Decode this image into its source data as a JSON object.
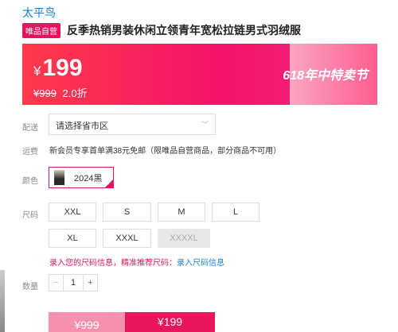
{
  "brand": "太平鸟",
  "vip_badge": "唯品自营",
  "product_title": "反季热销男装休闲立领青年宽松拉链男式羽绒服",
  "price": {
    "currency": "¥",
    "current": "199",
    "original": "¥999",
    "discount": "2.0折",
    "promo": "618年中特卖节"
  },
  "delivery": {
    "label": "配送",
    "placeholder": "请选择省市区"
  },
  "shipping": {
    "label": "运费",
    "text": "新会员专享首单满38元免邮（限唯品自营商品，部分商品不可用）"
  },
  "color": {
    "label": "颜色",
    "selected": "2024黑"
  },
  "size": {
    "label": "尺码",
    "options": [
      "XXL",
      "S",
      "M",
      "L",
      "XL",
      "XXXL",
      "XXXXL"
    ],
    "disabled": [
      "XXXXL"
    ],
    "hint_prefix": "录入您的尺码信息，精准推荐尺码：",
    "hint_link": "录入尺码信息"
  },
  "quantity": {
    "label": "数量",
    "value": "1",
    "minus": "−",
    "plus": "+"
  },
  "buttons": {
    "original_price": "¥999",
    "buy_price": "¥199"
  },
  "colors": {
    "accent": "#e4155f",
    "link": "#1a7fd1"
  }
}
